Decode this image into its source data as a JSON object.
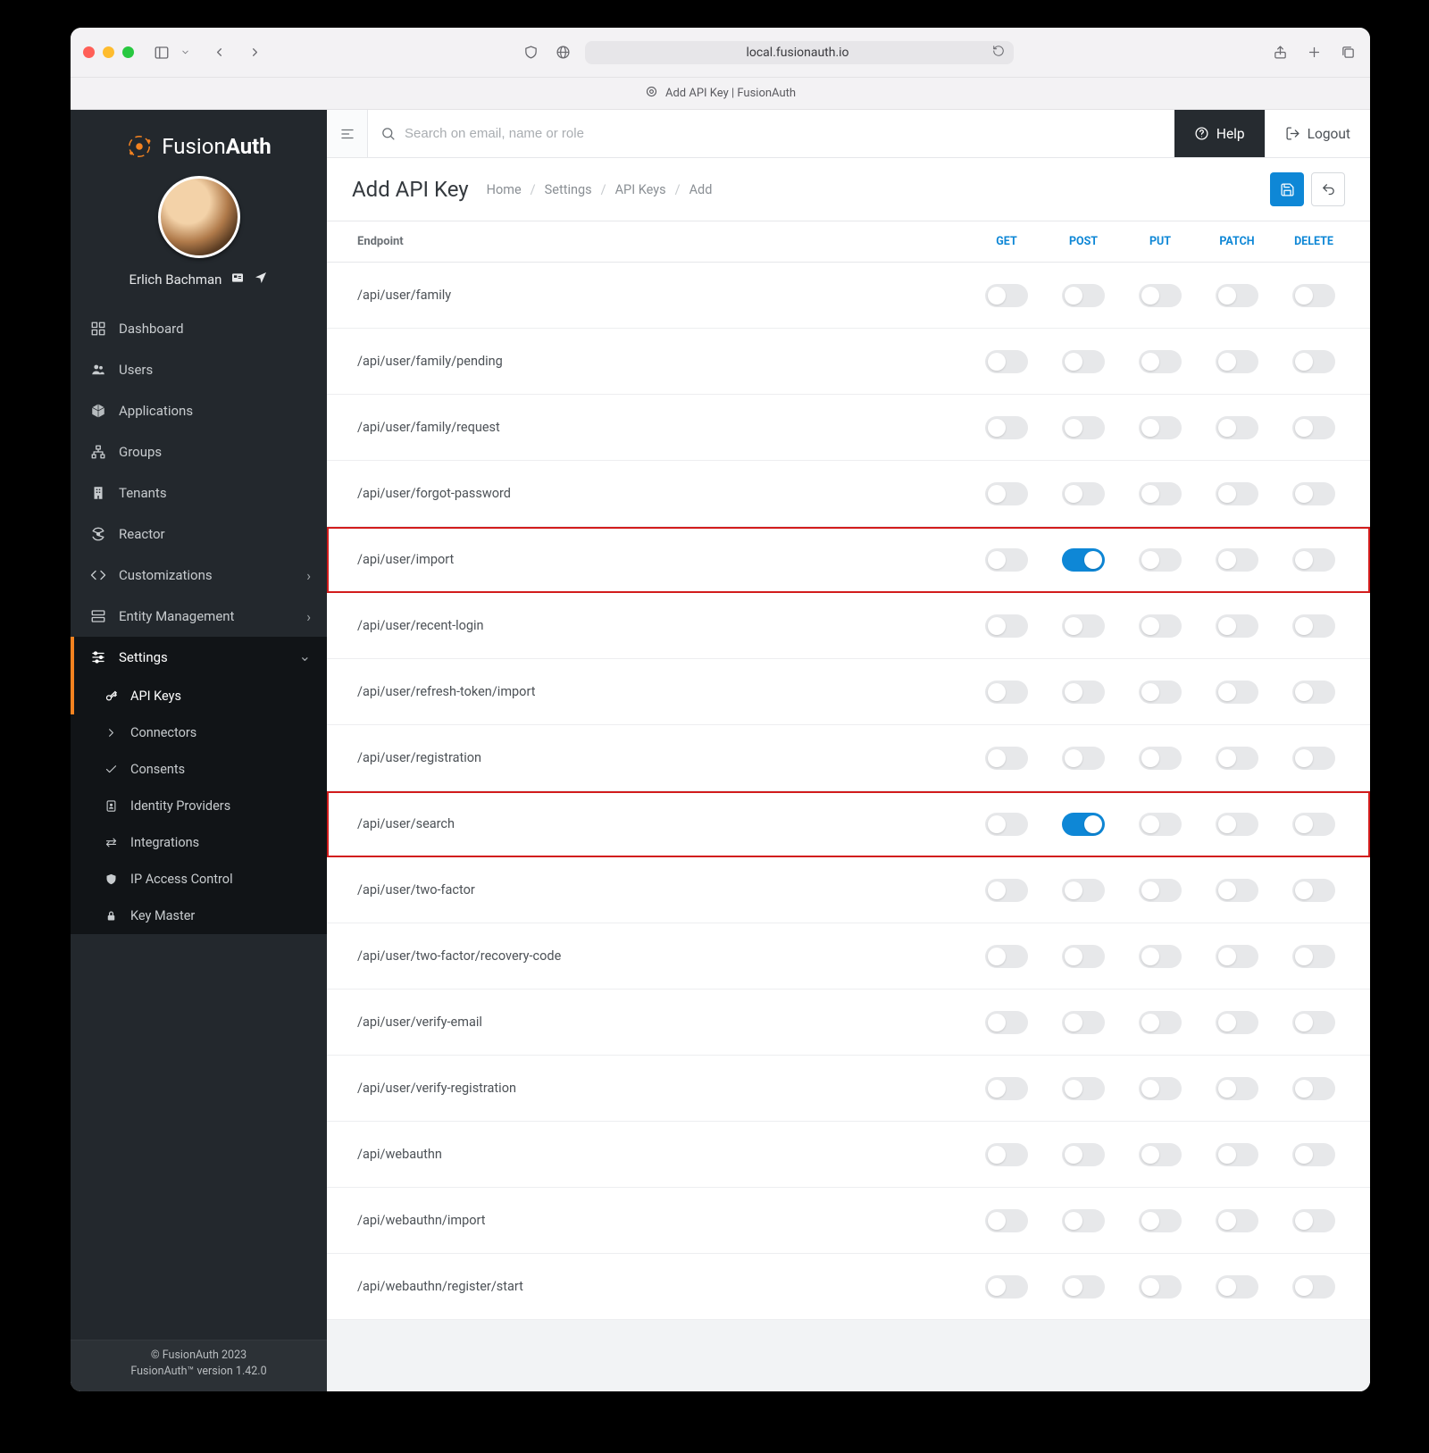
{
  "browser": {
    "address": "local.fusionauth.io",
    "tab_title": "Add API Key | FusionAuth"
  },
  "brand": {
    "name_light": "Fusion",
    "name_bold": "Auth"
  },
  "user": {
    "name": "Erlich Bachman"
  },
  "sidebar": {
    "items": [
      {
        "label": "Dashboard"
      },
      {
        "label": "Users"
      },
      {
        "label": "Applications"
      },
      {
        "label": "Groups"
      },
      {
        "label": "Tenants"
      },
      {
        "label": "Reactor"
      }
    ],
    "sections": [
      {
        "label": "Customizations"
      },
      {
        "label": "Entity Management"
      }
    ],
    "settings_label": "Settings",
    "settings_sub": [
      {
        "label": "API Keys"
      },
      {
        "label": "Connectors"
      },
      {
        "label": "Consents"
      },
      {
        "label": "Identity Providers"
      },
      {
        "label": "Integrations"
      },
      {
        "label": "IP Access Control"
      },
      {
        "label": "Key Master"
      }
    ],
    "footer_line1": "© FusionAuth 2023",
    "footer_line2": "FusionAuth™ version 1.42.0"
  },
  "topbar": {
    "search_placeholder": "Search on email, name or role",
    "help": "Help",
    "logout": "Logout"
  },
  "page": {
    "title": "Add API Key",
    "crumbs": [
      "Home",
      "Settings",
      "API Keys",
      "Add"
    ]
  },
  "table": {
    "header_label": "Endpoint",
    "methods": [
      "GET",
      "POST",
      "PUT",
      "PATCH",
      "DELETE"
    ],
    "rows": [
      {
        "endpoint": "/api/user/family",
        "on": [],
        "highlight": false
      },
      {
        "endpoint": "/api/user/family/pending",
        "on": [],
        "highlight": false
      },
      {
        "endpoint": "/api/user/family/request",
        "on": [],
        "highlight": false
      },
      {
        "endpoint": "/api/user/forgot-password",
        "on": [],
        "highlight": false
      },
      {
        "endpoint": "/api/user/import",
        "on": [
          "POST"
        ],
        "highlight": true
      },
      {
        "endpoint": "/api/user/recent-login",
        "on": [],
        "highlight": false
      },
      {
        "endpoint": "/api/user/refresh-token/import",
        "on": [],
        "highlight": false
      },
      {
        "endpoint": "/api/user/registration",
        "on": [],
        "highlight": false
      },
      {
        "endpoint": "/api/user/search",
        "on": [
          "POST"
        ],
        "highlight": true
      },
      {
        "endpoint": "/api/user/two-factor",
        "on": [],
        "highlight": false
      },
      {
        "endpoint": "/api/user/two-factor/recovery-code",
        "on": [],
        "highlight": false
      },
      {
        "endpoint": "/api/user/verify-email",
        "on": [],
        "highlight": false
      },
      {
        "endpoint": "/api/user/verify-registration",
        "on": [],
        "highlight": false
      },
      {
        "endpoint": "/api/webauthn",
        "on": [],
        "highlight": false
      },
      {
        "endpoint": "/api/webauthn/import",
        "on": [],
        "highlight": false
      },
      {
        "endpoint": "/api/webauthn/register/start",
        "on": [],
        "highlight": false
      }
    ]
  }
}
